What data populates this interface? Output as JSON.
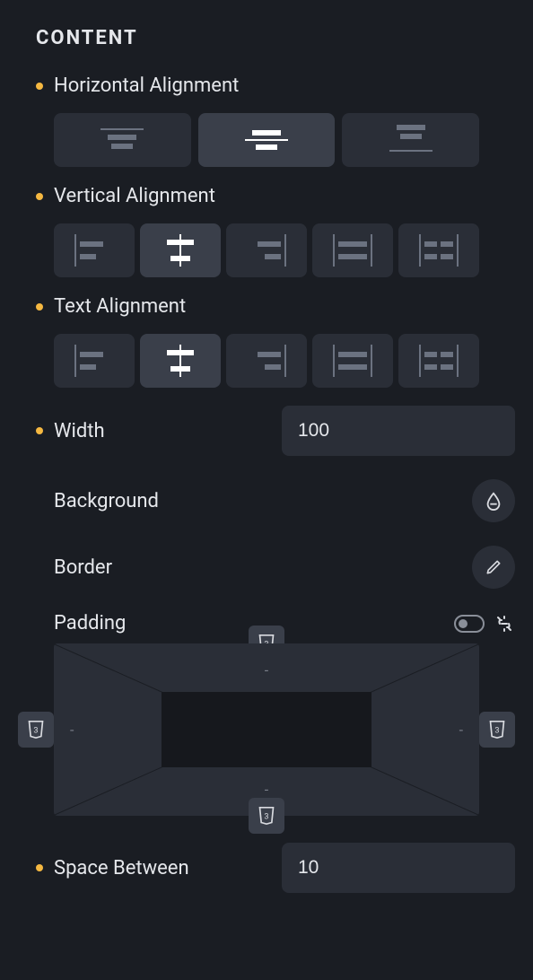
{
  "section": {
    "title": "CONTENT"
  },
  "horizontal_alignment": {
    "label": "Horizontal Alignment",
    "options": [
      "top",
      "center",
      "bottom"
    ],
    "selected": "center"
  },
  "vertical_alignment": {
    "label": "Vertical Alignment",
    "options": [
      "left",
      "center",
      "right",
      "stretch",
      "between"
    ],
    "selected": "center"
  },
  "text_alignment": {
    "label": "Text Alignment",
    "options": [
      "left",
      "center",
      "right",
      "stretch",
      "between"
    ],
    "selected": "center"
  },
  "width": {
    "label": "Width",
    "value": "100",
    "unit_icon": "css3-icon"
  },
  "background": {
    "label": "Background"
  },
  "border": {
    "label": "Border"
  },
  "padding": {
    "label": "Padding",
    "top": "-",
    "right": "-",
    "bottom": "-",
    "left": "-",
    "unit_icon": "css3-icon",
    "linked": false
  },
  "space_between": {
    "label": "Space Between",
    "value": "10",
    "unit_icon": "css3-icon"
  }
}
